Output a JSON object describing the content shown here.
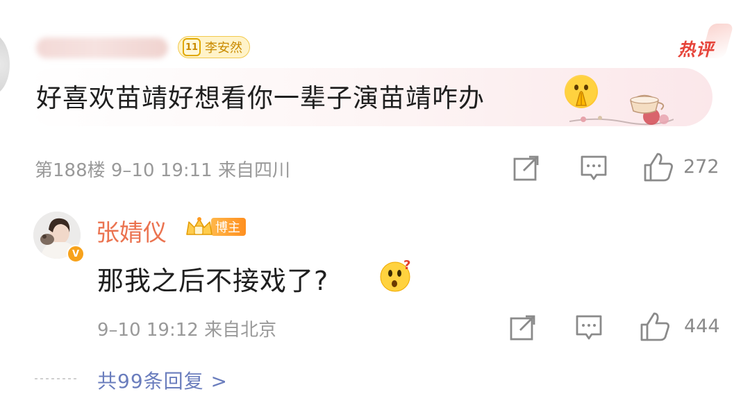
{
  "top_comment": {
    "fan_badge": {
      "level": "11",
      "name": "李安然"
    },
    "hot_tag": "热评",
    "text": "好喜欢苗靖好想看你一辈子演苗靖咋办",
    "emoji": "pray-emoji",
    "meta": "第188楼 9–10 19:11 来自四川",
    "like_count": "272"
  },
  "reply": {
    "author": "张婧仪",
    "role_badge": "博主",
    "text": "那我之后不接戏了?",
    "emoji": "thinking-face-emoji",
    "meta": "9–10 19:12 来自北京",
    "like_count": "444"
  },
  "more_replies": "共99条回复 >",
  "colors": {
    "name_orange": "#eb7350",
    "hot_red": "#e6443a",
    "meta_gray": "#999999",
    "link_blue": "#6a7dbd",
    "badge_gold": "#f2c94c"
  }
}
